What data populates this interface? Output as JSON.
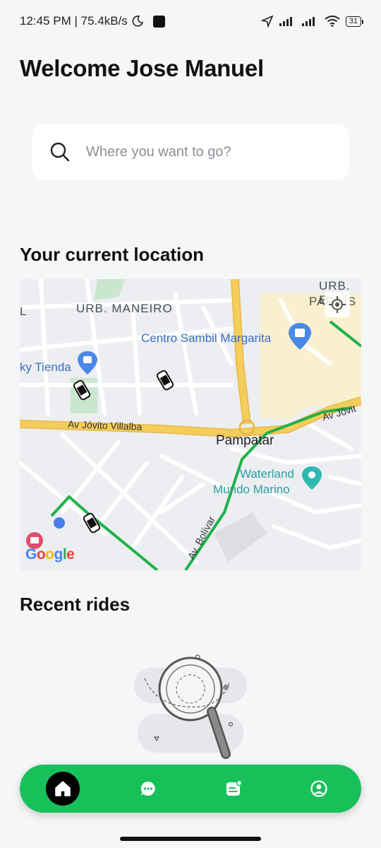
{
  "status_bar": {
    "time_speed": "12:45 PM | 75.4kB/s",
    "moon_icon": "moon-icon",
    "battery": "31"
  },
  "header": {
    "title": "Welcome Jose Manuel"
  },
  "search": {
    "placeholder": "Where you want to go?"
  },
  "sections": {
    "current_location": "Your current location",
    "recent_rides": "Recent rides"
  },
  "map": {
    "labels": {
      "urb_maneiro": "URB. MANEIRO",
      "urb_top": "URB. E",
      "paraiso": "PARAÍS",
      "l_edge": "L",
      "centro_sambil": "Centro Sambil Margarita",
      "tienda": "ky Tienda",
      "av_jovito_villalba": "Av Jóvito Villalba",
      "av_jovito_right": "Av Jóvit",
      "pampatar": "Pampatar",
      "waterland": "Waterland",
      "mundo_marino": "Mundo Marino",
      "av_bolivar": "Av. Bolívar"
    },
    "google": [
      "G",
      "o",
      "o",
      "g",
      "l",
      "e"
    ],
    "colors": {
      "route": "#1fb14a",
      "main_road": "#f5cd5a",
      "user_dot": "#4a7df0"
    }
  },
  "bottom_nav": {
    "items": [
      {
        "name": "home",
        "icon": "home-icon",
        "active": true
      },
      {
        "name": "chat",
        "icon": "chat-icon",
        "active": false
      },
      {
        "name": "rides",
        "icon": "receipt-icon",
        "active": false
      },
      {
        "name": "profile",
        "icon": "profile-icon",
        "active": false
      }
    ],
    "accent": "#17c15a"
  }
}
